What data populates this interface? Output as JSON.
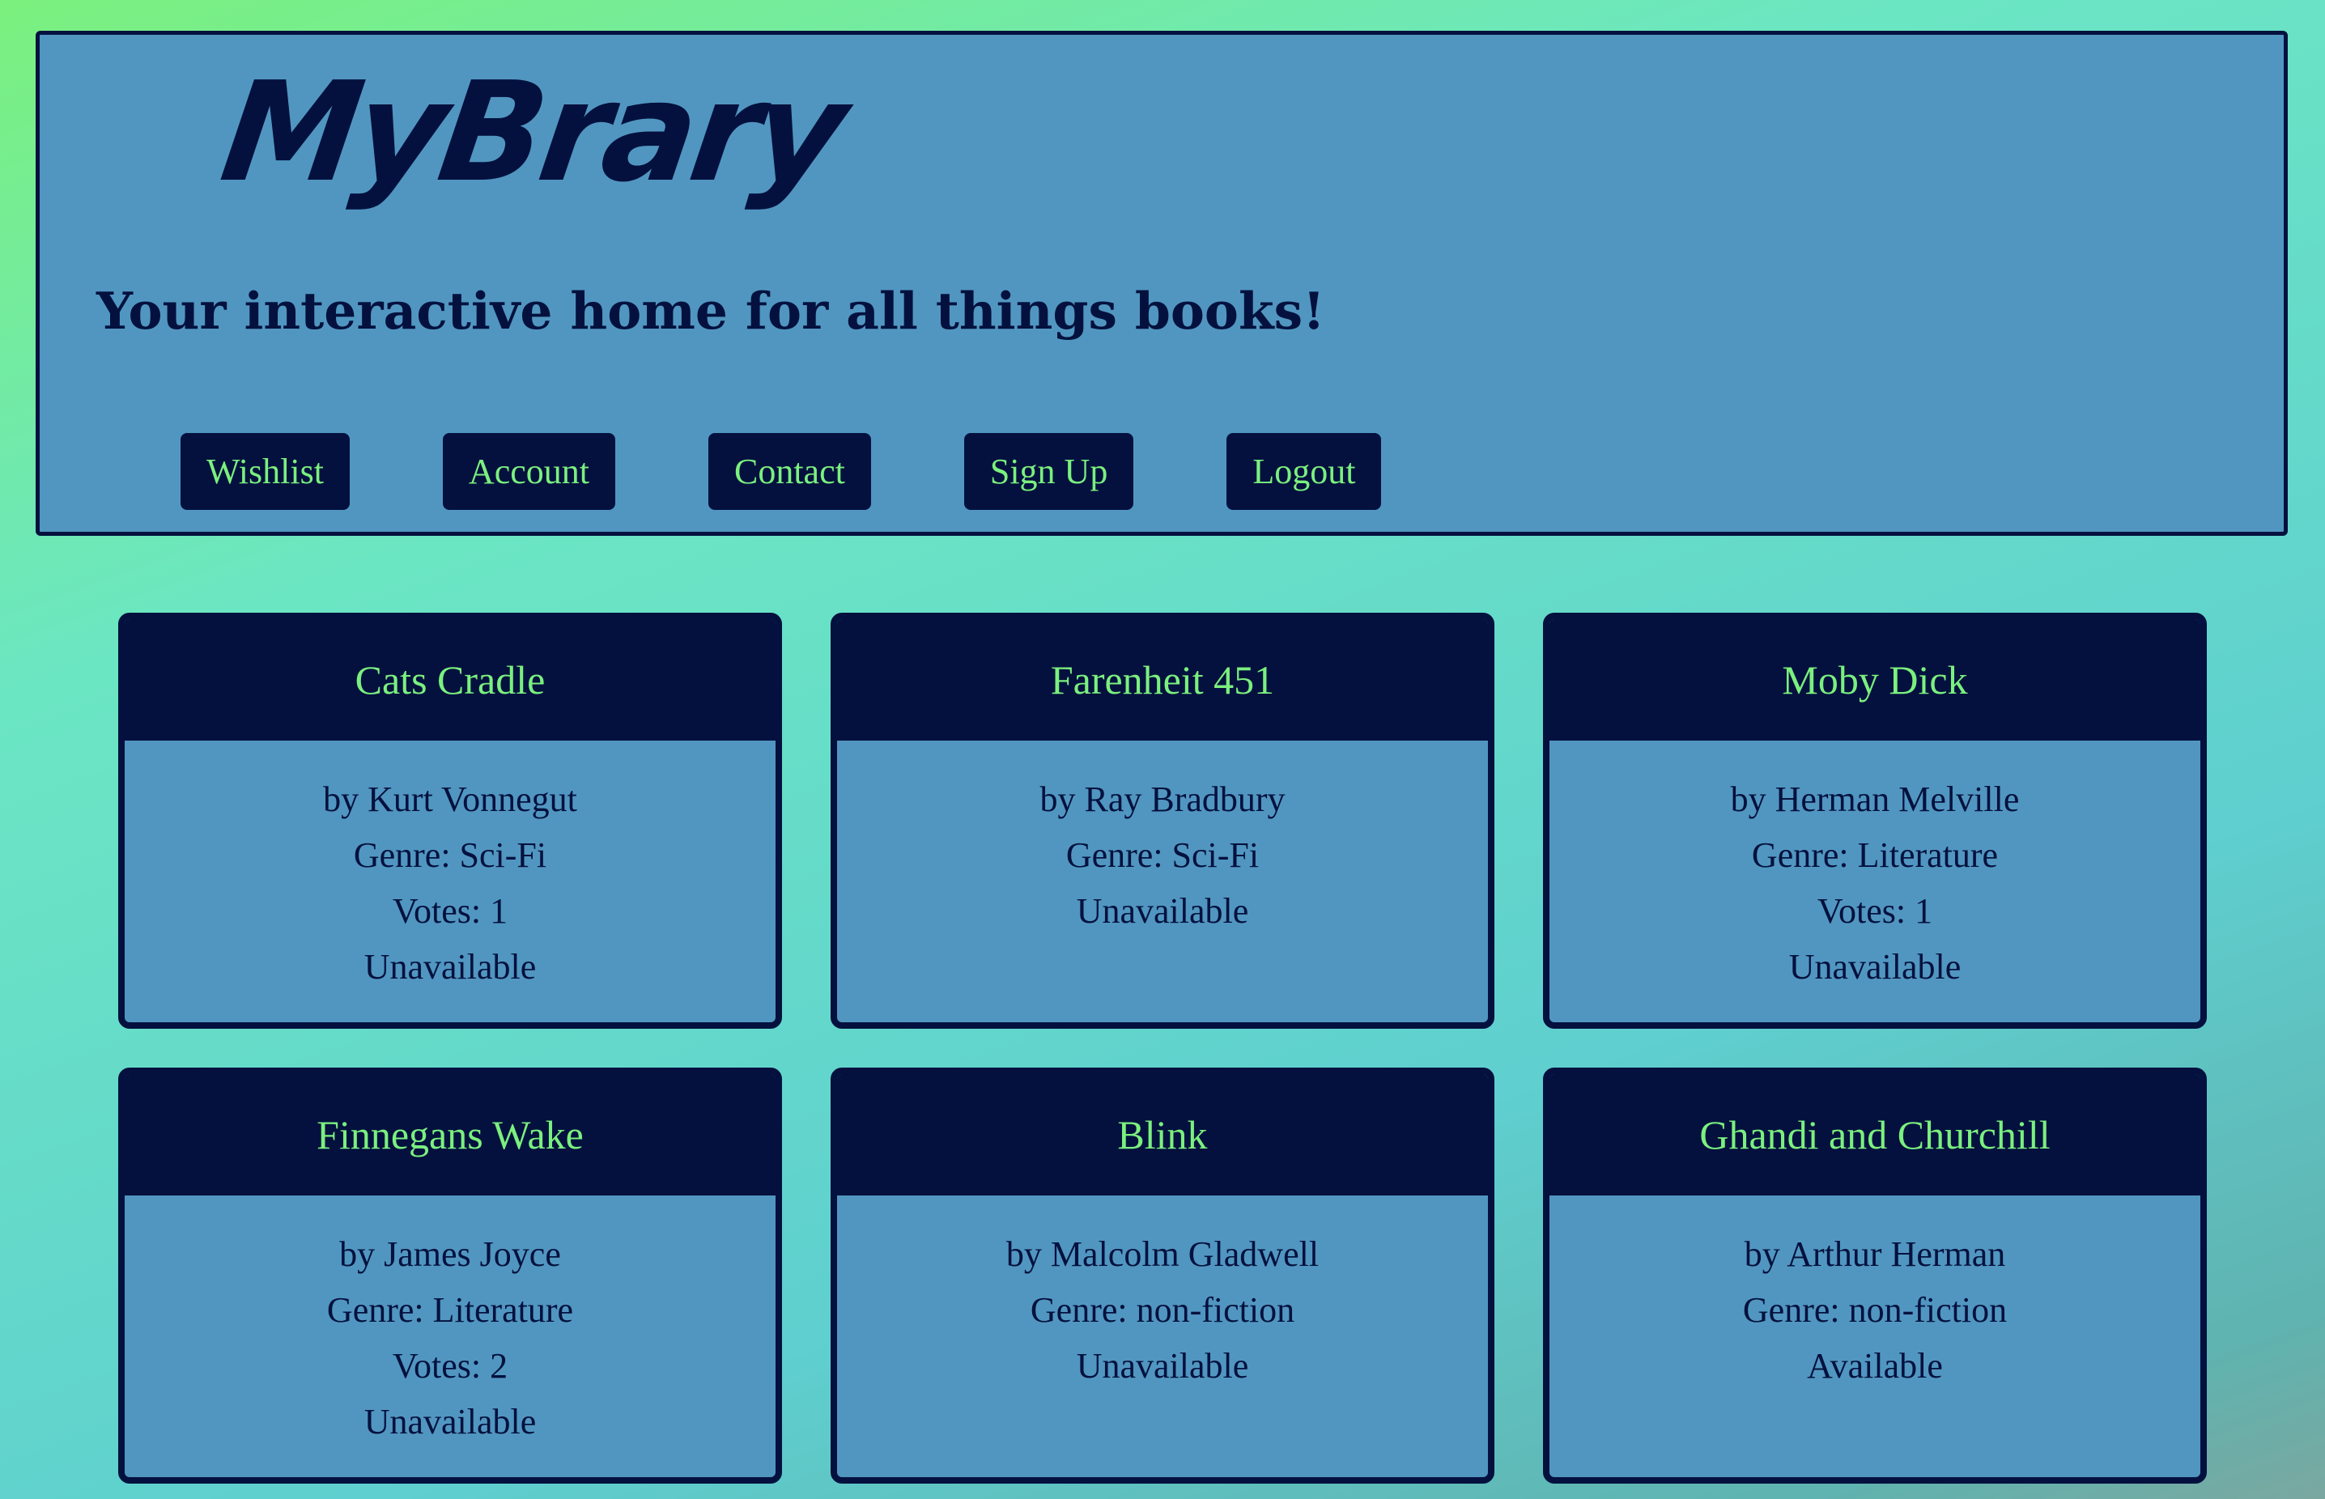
{
  "header": {
    "logo_text": "MyBrary",
    "tagline": "Your interactive home for all things books!",
    "nav": [
      "Wishlist",
      "Account",
      "Contact",
      "Sign Up",
      "Logout"
    ]
  },
  "books": [
    {
      "title": "Cats Cradle",
      "author": "by Kurt Vonnegut",
      "genre": "Genre: Sci-Fi",
      "votes": "Votes: 1",
      "status": "Unavailable"
    },
    {
      "title": "Farenheit 451",
      "author": "by Ray Bradbury",
      "genre": "Genre: Sci-Fi",
      "votes": "",
      "status": "Unavailable"
    },
    {
      "title": "Moby Dick",
      "author": "by Herman Melville",
      "genre": "Genre: Literature",
      "votes": "Votes: 1",
      "status": "Unavailable"
    },
    {
      "title": "Finnegans Wake",
      "author": "by James Joyce",
      "genre": "Genre: Literature",
      "votes": "Votes: 2",
      "status": "Unavailable"
    },
    {
      "title": "Blink",
      "author": "by Malcolm Gladwell",
      "genre": "Genre: non-fiction",
      "votes": "",
      "status": "Unavailable"
    },
    {
      "title": "Ghandi and Churchill",
      "author": "by Arthur Herman",
      "genre": "Genre: non-fiction",
      "votes": "",
      "status": "Available"
    }
  ],
  "colors": {
    "navy": "#04113e",
    "panel_blue": "#5196c0",
    "accent_green": "#7bf07e"
  }
}
